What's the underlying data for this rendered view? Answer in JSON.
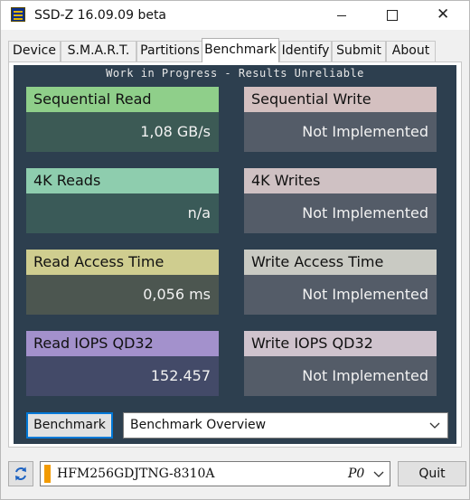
{
  "window": {
    "title": "SSD-Z 16.09.09 beta",
    "close_glyph": "✕"
  },
  "tabs": [
    {
      "label": "Device",
      "active": false
    },
    {
      "label": "S.M.A.R.T.",
      "active": false
    },
    {
      "label": "Partitions",
      "active": false
    },
    {
      "label": "Benchmark",
      "active": true
    },
    {
      "label": "Identify",
      "active": false
    },
    {
      "label": "Submit",
      "active": false
    },
    {
      "label": "About",
      "active": false
    }
  ],
  "benchmark": {
    "banner": "Work in Progress - Results Unreliable",
    "cards": {
      "seq_read": {
        "label": "Sequential Read",
        "value": "1,08 GB/s"
      },
      "seq_write": {
        "label": "Sequential Write",
        "value": "Not Implemented"
      },
      "k4_reads": {
        "label": "4K Reads",
        "value": "n/a"
      },
      "k4_writes": {
        "label": "4K Writes",
        "value": "Not Implemented"
      },
      "read_access": {
        "label": "Read Access Time",
        "value": "0,056 ms"
      },
      "write_access": {
        "label": "Write Access Time",
        "value": "Not Implemented"
      },
      "read_iops": {
        "label": "Read IOPS QD32",
        "value": "152.457"
      },
      "write_iops": {
        "label": "Write IOPS QD32",
        "value": "Not Implemented"
      }
    },
    "button_label": "Benchmark",
    "overview_selected": "Benchmark Overview"
  },
  "footer": {
    "drive_model": "HFM256GDJTNG-8310A",
    "drive_port": "P0",
    "quit_label": "Quit"
  },
  "colors": {
    "panel_background": "#2d3f4f",
    "seq_read_header": "#8fcf8a",
    "seq_read_body": "#3c5a55",
    "k4_reads_header": "#8ecdae",
    "k4_reads_body": "#3a5a58",
    "read_access_header": "#cfcd8f",
    "read_access_body": "#4c5650",
    "read_iops_header": "#a391cc",
    "read_iops_body": "#434a68",
    "seq_write_header": "#d4c0c0",
    "k4_writes_header": "#cfc1c3",
    "write_access_header": "#c9cac3",
    "write_iops_header": "#cfc3cd",
    "write_body": "#545c68",
    "drive_marker": "#f29a00"
  },
  "icons": {
    "app": "ssd-z-app-icon",
    "refresh": "refresh-icon",
    "dropdown": "chevron-down-icon"
  }
}
